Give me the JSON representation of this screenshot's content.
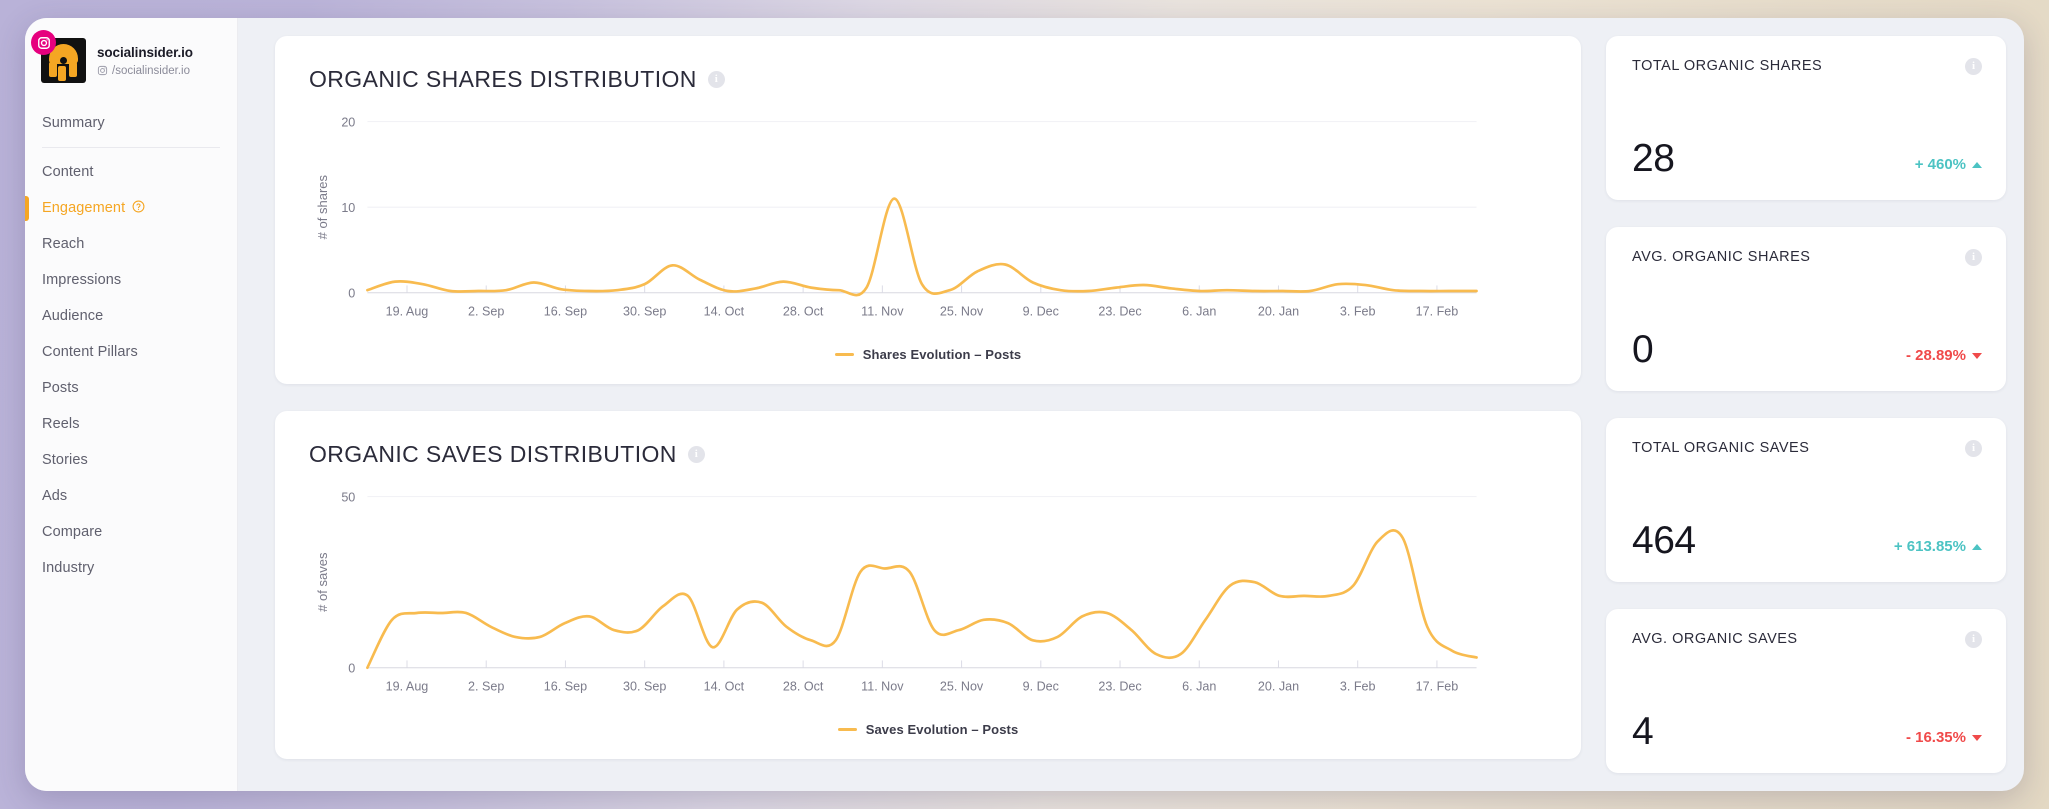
{
  "sidebar": {
    "brand": {
      "name": "socialinsider.io",
      "handle": "/socialinsider.io",
      "platform_icon": "instagram-icon",
      "avatar_icon": "profile-avatar"
    },
    "items": [
      {
        "label": "Summary",
        "active": false,
        "has_help": false
      },
      {
        "label": "Content",
        "active": false,
        "has_help": false
      },
      {
        "label": "Engagement",
        "active": true,
        "has_help": true
      },
      {
        "label": "Reach",
        "active": false,
        "has_help": false
      },
      {
        "label": "Impressions",
        "active": false,
        "has_help": false
      },
      {
        "label": "Audience",
        "active": false,
        "has_help": false
      },
      {
        "label": "Content Pillars",
        "active": false,
        "has_help": false
      },
      {
        "label": "Posts",
        "active": false,
        "has_help": false
      },
      {
        "label": "Reels",
        "active": false,
        "has_help": false
      },
      {
        "label": "Stories",
        "active": false,
        "has_help": false
      },
      {
        "label": "Ads",
        "active": false,
        "has_help": false
      },
      {
        "label": "Compare",
        "active": false,
        "has_help": false
      },
      {
        "label": "Industry",
        "active": false,
        "has_help": false
      }
    ]
  },
  "charts": [
    {
      "title": "ORGANIC SHARES DISTRIBUTION",
      "legend": "Shares Evolution – Posts",
      "info": "i"
    },
    {
      "title": "ORGANIC SAVES DISTRIBUTION",
      "legend": "Saves Evolution – Posts",
      "info": "i"
    }
  ],
  "kpis": [
    {
      "label": "TOTAL ORGANIC SHARES",
      "value": "28",
      "delta": "+ 460%",
      "direction": "up",
      "info": "i"
    },
    {
      "label": "AVG. ORGANIC SHARES",
      "value": "0",
      "delta": "- 28.89%",
      "direction": "down",
      "info": "i"
    },
    {
      "label": "TOTAL ORGANIC SAVES",
      "value": "464",
      "delta": "+ 613.85%",
      "direction": "up",
      "info": "i"
    },
    {
      "label": "AVG. ORGANIC SAVES",
      "value": "4",
      "delta": "- 16.35%",
      "direction": "down",
      "info": "i"
    }
  ],
  "colors": {
    "accent_orange": "#f5a623",
    "line_orange": "#f8bb4f",
    "positive_teal": "#4cc3c3",
    "negative_red": "#f04a4a",
    "text_dark": "#2b2b3a",
    "text_muted": "#7b7b8a"
  },
  "chart_data": [
    {
      "type": "line",
      "title": "ORGANIC SHARES DISTRIBUTION",
      "xlabel": "",
      "ylabel": "# of shares",
      "ylim": [
        0,
        20
      ],
      "yticks": [
        0,
        10,
        20
      ],
      "grid": true,
      "legend_position": "bottom",
      "categories": [
        "19. Aug",
        "2. Sep",
        "16. Sep",
        "30. Sep",
        "14. Oct",
        "28. Oct",
        "11. Nov",
        "25. Nov",
        "9. Dec",
        "23. Dec",
        "6. Jan",
        "20. Jan",
        "3. Feb",
        "17. Feb"
      ],
      "series": [
        {
          "name": "Shares Evolution – Posts",
          "color": "#f8bb4f",
          "x": [
            0,
            0.5,
            1,
            1.5,
            2,
            2.5,
            3,
            3.5,
            4,
            4.5,
            5,
            5.5,
            6,
            6.5,
            7,
            7.5,
            8,
            8.5,
            9,
            9.5,
            10,
            10.5,
            11,
            11.5,
            12,
            12.5,
            13
          ],
          "values": [
            0.3,
            1.3,
            1.0,
            0.2,
            0.2,
            0.3,
            1.2,
            0.4,
            0.2,
            0.3,
            1.0,
            3.2,
            1.5,
            0.2,
            0.5,
            1.3,
            0.6,
            0.3,
            0.6,
            11.0,
            1.0,
            0.3,
            2.5,
            3.3,
            1.2,
            0.3,
            0.2,
            0.6,
            0.9,
            0.5,
            0.2,
            0.3,
            0.2,
            0.2,
            0.2,
            1.0,
            0.9,
            0.3,
            0.2,
            0.2,
            0.2
          ]
        }
      ]
    },
    {
      "type": "line",
      "title": "ORGANIC SAVES DISTRIBUTION",
      "xlabel": "",
      "ylabel": "# of saves",
      "ylim": [
        0,
        50
      ],
      "yticks": [
        0,
        50
      ],
      "grid": true,
      "legend_position": "bottom",
      "categories": [
        "19. Aug",
        "2. Sep",
        "16. Sep",
        "30. Sep",
        "14. Oct",
        "28. Oct",
        "11. Nov",
        "25. Nov",
        "9. Dec",
        "23. Dec",
        "6. Jan",
        "20. Jan",
        "3. Feb",
        "17. Feb"
      ],
      "series": [
        {
          "name": "Saves Evolution – Posts",
          "color": "#f8bb4f",
          "x": [
            0,
            0.5,
            1,
            1.5,
            2,
            2.5,
            3,
            3.5,
            4,
            4.5,
            5,
            5.5,
            6,
            6.5,
            7,
            7.5,
            8,
            8.5,
            9,
            9.5,
            10,
            10.5,
            11,
            11.5,
            12,
            12.5,
            13
          ],
          "values": [
            0,
            14,
            16,
            16,
            16,
            12,
            9,
            9,
            13,
            15,
            11,
            11,
            18,
            21,
            6,
            17,
            19,
            12,
            8,
            8,
            28,
            29,
            28,
            11,
            11,
            14,
            13,
            8,
            9,
            15,
            16,
            11,
            4,
            4,
            14,
            24,
            25,
            21,
            21,
            21,
            24,
            37,
            38,
            12,
            5,
            3
          ]
        }
      ]
    }
  ]
}
